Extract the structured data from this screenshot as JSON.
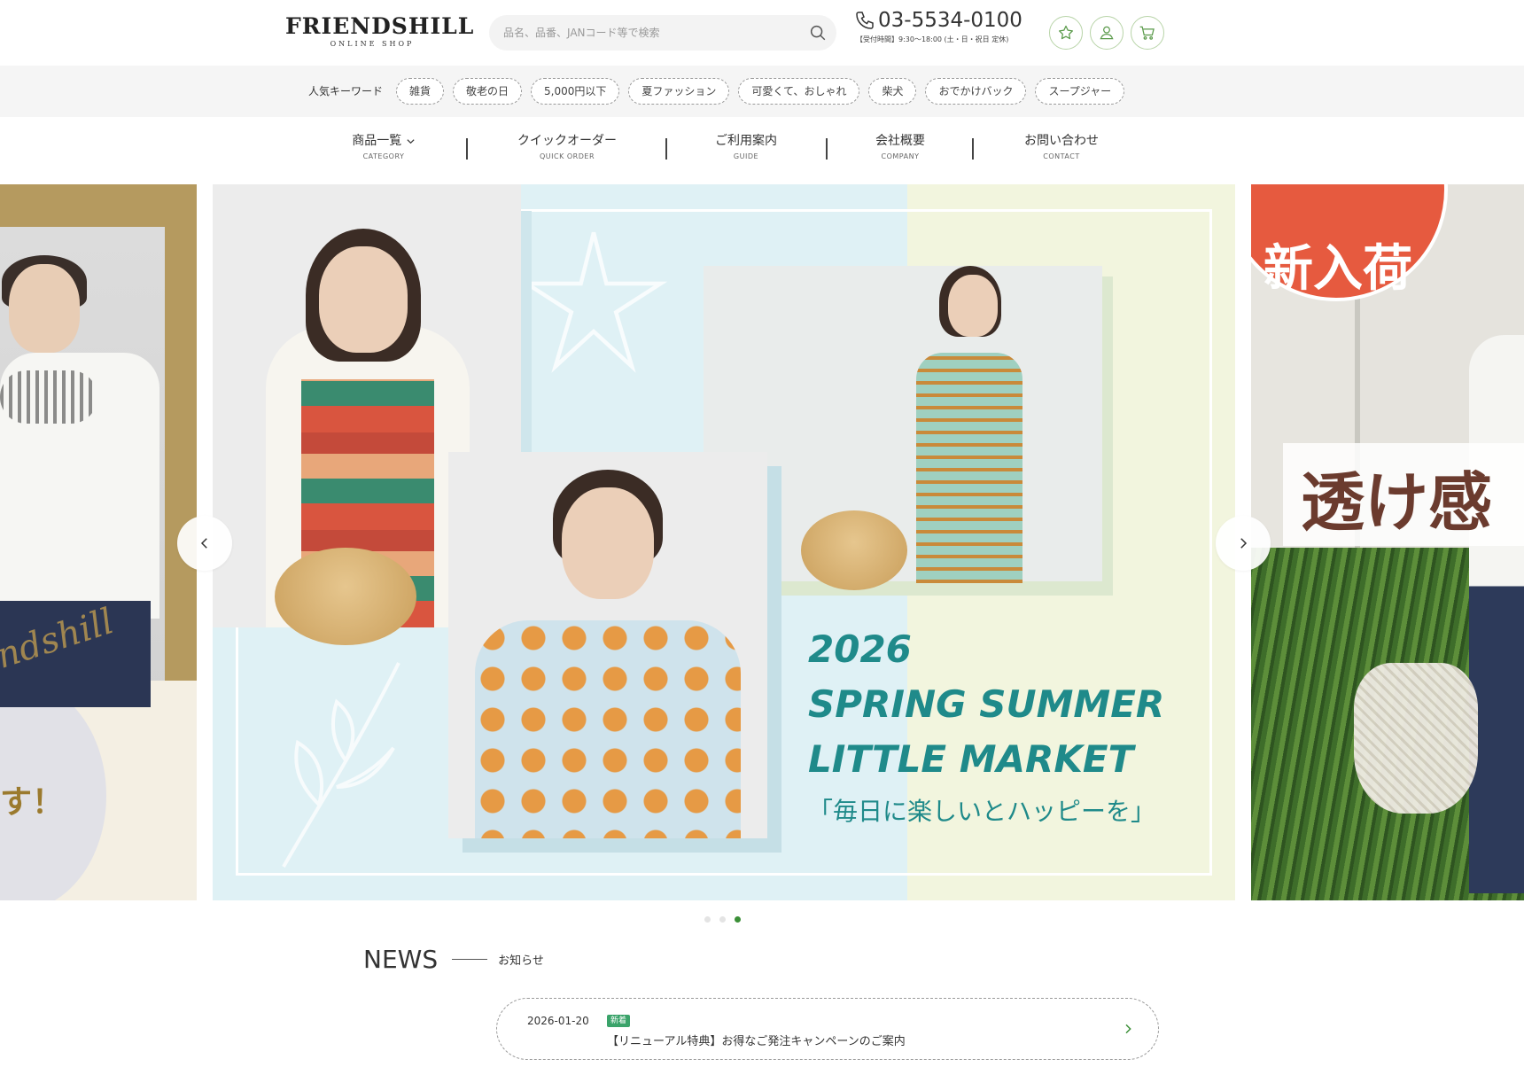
{
  "header": {
    "logo_main": "FRIENDSHILL",
    "logo_sub": "ONLINE SHOP",
    "search_placeholder": "品名、品番、JANコード等で検索",
    "phone": "03-5534-0100",
    "hours": "【受付時間】9:30〜18:00 (土・日・祝日 定休)",
    "icons": [
      "star-icon",
      "user-icon",
      "cart-icon"
    ]
  },
  "keywords": {
    "title": "人気キーワード",
    "tags": [
      "雑貨",
      "敬老の日",
      "5,000円以下",
      "夏ファッション",
      "可愛くて、おしゃれ",
      "柴犬",
      "おでかけバック",
      "スープジャー"
    ]
  },
  "nav": {
    "items": [
      {
        "label": "商品一覧",
        "sub": "CATEGORY"
      },
      {
        "label": "クイックオーダー",
        "sub": "QUICK ORDER"
      },
      {
        "label": "ご利用案内",
        "sub": "GUIDE"
      },
      {
        "label": "会社概要",
        "sub": "COMPANY"
      },
      {
        "label": "お問い合わせ",
        "sub": "CONTACT"
      }
    ]
  },
  "carousel": {
    "left_caption": "す！",
    "main_title_1": "2026",
    "main_title_2": "SPRING SUMMER",
    "main_title_3": "LITTLE MARKET",
    "main_catch": "「毎日に楽しいとハッピーを」",
    "right_badge": "新入荷",
    "right_band": "透け感",
    "dots": 3,
    "active_dot": 2,
    "colors": {
      "accent": "#1f8a8a",
      "badge": "#e65a3f",
      "dot_active": "#3b8f37"
    }
  },
  "news": {
    "title": "NEWS",
    "subtitle": "お知らせ",
    "items": [
      {
        "date": "2026-01-20",
        "badge": "新着",
        "text": "【リニューアル特典】お得なご発注キャンペーンのご案内"
      }
    ]
  }
}
